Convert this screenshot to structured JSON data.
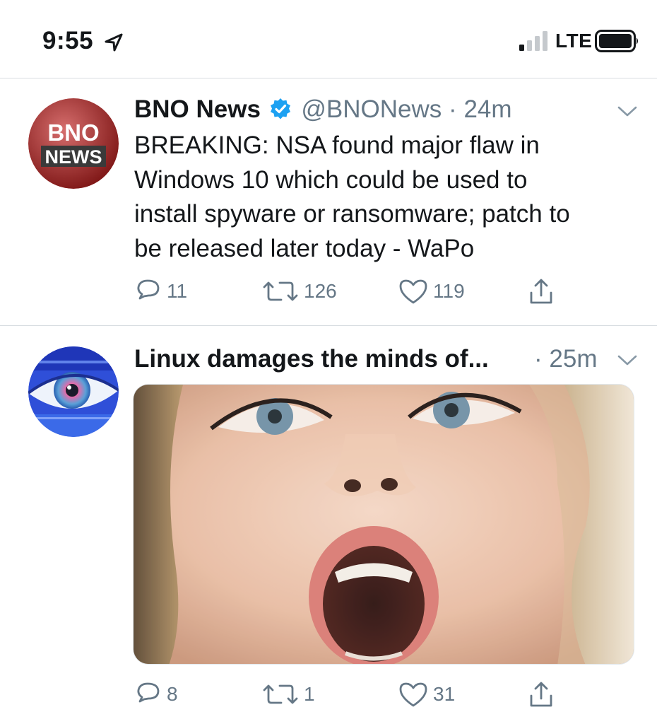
{
  "status_bar": {
    "time": "9:55",
    "network": "LTE",
    "icons": {
      "location": "location-arrow-icon",
      "signal": "signal-bars-icon",
      "battery": "battery-icon"
    }
  },
  "tweets": [
    {
      "avatar": {
        "line1": "BNO",
        "line2": "NEWS",
        "color": "#c0201f"
      },
      "name": "BNO News",
      "verified": true,
      "handle": "@BNONews",
      "separator": "·",
      "time_ago": "24m",
      "lines": [
        "BREAKING: NSA found major flaw in",
        "Windows 10 which could be used to",
        "install spyware or ransomware; patch to",
        "be released later today - WaPo"
      ],
      "replies": "11",
      "retweets": "126",
      "likes": "119"
    },
    {
      "avatar": {
        "icon": "eye-avatar-icon"
      },
      "name": "Linux damages the minds of...",
      "separator": "·",
      "time_ago": "25m",
      "media": {
        "icon": "shocked-face-photo-icon"
      },
      "replies": "8",
      "retweets": "1",
      "likes": "31"
    }
  ],
  "colors": {
    "text": "#14171a",
    "secondary": "#657786",
    "verified": "#1da1f2",
    "divider": "#d8dde1"
  }
}
